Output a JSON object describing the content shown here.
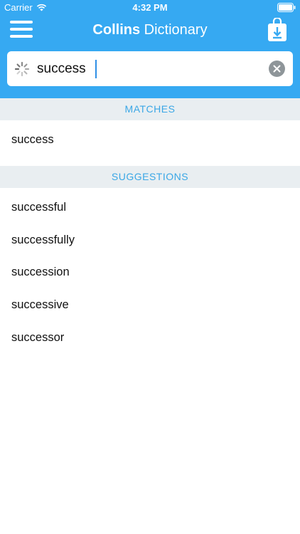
{
  "status_bar": {
    "carrier": "Carrier",
    "time": "4:32 PM"
  },
  "header": {
    "brand": "Collins",
    "title_rest": " Dictionary",
    "menu_icon": "hamburger-menu-icon",
    "download_icon": "download-bag-icon",
    "background_color": "#36a9f2"
  },
  "search": {
    "value": "success",
    "loading_icon": "spinner-icon",
    "clear_icon": "clear-x-icon"
  },
  "matches": {
    "header": "MATCHES",
    "items": [
      "success"
    ]
  },
  "suggestions": {
    "header": "SUGGESTIONS",
    "items": [
      "successful",
      "successfully",
      "succession",
      "successive",
      "successor"
    ]
  }
}
